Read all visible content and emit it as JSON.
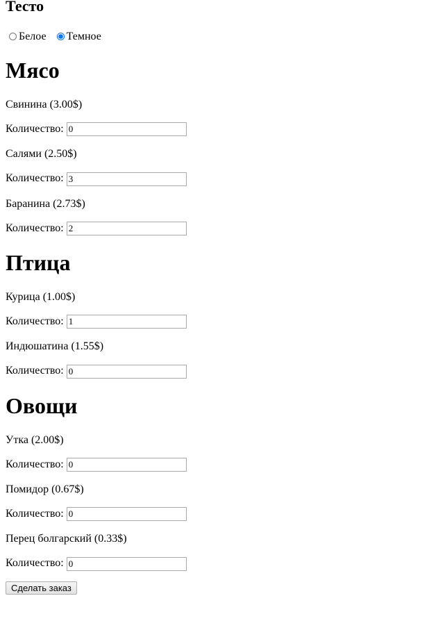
{
  "dough": {
    "title": "Тесто",
    "options": [
      {
        "label": "Белое",
        "checked": false
      },
      {
        "label": "Темное",
        "checked": true
      }
    ]
  },
  "quantity_label": "Количество:",
  "sections": [
    {
      "title": "Мясо",
      "items": [
        {
          "label": "Свинина (3.00$)",
          "quantity": "0"
        },
        {
          "label": "Салями (2.50$)",
          "quantity": "3"
        },
        {
          "label": "Баранина (2.73$)",
          "quantity": "2"
        }
      ]
    },
    {
      "title": "Птица",
      "items": [
        {
          "label": "Курица (1.00$)",
          "quantity": "1"
        },
        {
          "label": "Индюшатина (1.55$)",
          "quantity": "0"
        }
      ]
    },
    {
      "title": "Овощи",
      "items": [
        {
          "label": "Утка (2.00$)",
          "quantity": "0"
        },
        {
          "label": "Помидор (0.67$)",
          "quantity": "0"
        },
        {
          "label": "Перец болгарский (0.33$)",
          "quantity": "0"
        }
      ]
    }
  ],
  "submit_label": "Сделать заказ"
}
